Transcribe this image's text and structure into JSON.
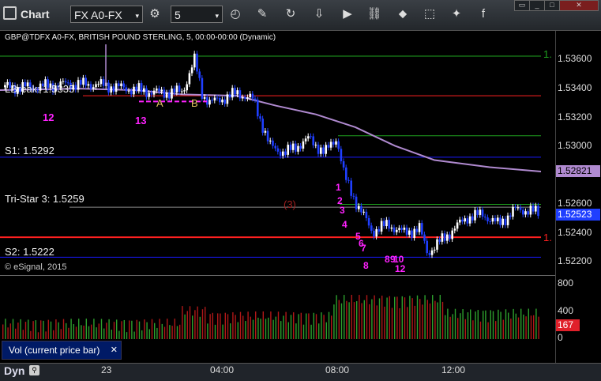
{
  "toolbar": {
    "app_title": "Chart",
    "symbol": "FX A0-FX",
    "interval": "5"
  },
  "chart": {
    "header": "GBP@TDFX A0-FX, BRITISH POUND STERLING, 5, 00:00-00:00 (Dynamic)",
    "watermark": "© eSignal, 2015",
    "price_ticks": [
      "1.53600",
      "1.53400",
      "1.53200",
      "1.53000",
      "1.52800",
      "1.52600",
      "1.52400",
      "1.52200"
    ],
    "last_price": "1.52523",
    "ma_price": "1.52821",
    "levels": {
      "lbreak": "LBreak: 1.5335",
      "s1": "S1: 1.5292",
      "tristar": "Tri-Star 3: 1.5259",
      "s2": "S2: 1.5222"
    },
    "marks": [
      "12",
      "13",
      "A",
      "B",
      "1",
      "2",
      "3",
      "4",
      "5",
      "6",
      "7",
      "8",
      "8",
      "9",
      "10",
      "12",
      "(3)",
      "1.",
      "1."
    ],
    "right_edge_1": "1.",
    "right_edge_2": "1."
  },
  "volume": {
    "label": "Vol (current price bar)",
    "ticks": [
      "800",
      "400",
      "0"
    ],
    "current": "167"
  },
  "time_axis": {
    "ticks": [
      "23",
      "04:00",
      "08:00",
      "12:00"
    ],
    "dyn": "Dyn"
  },
  "colors": {
    "up": "#ffffff",
    "down": "#1f3fff",
    "support": "#1a1aff",
    "resistance": "#ff2020",
    "green": "#1fa21f",
    "ma": "#b08ad0",
    "magenta": "#ff22ff"
  }
}
